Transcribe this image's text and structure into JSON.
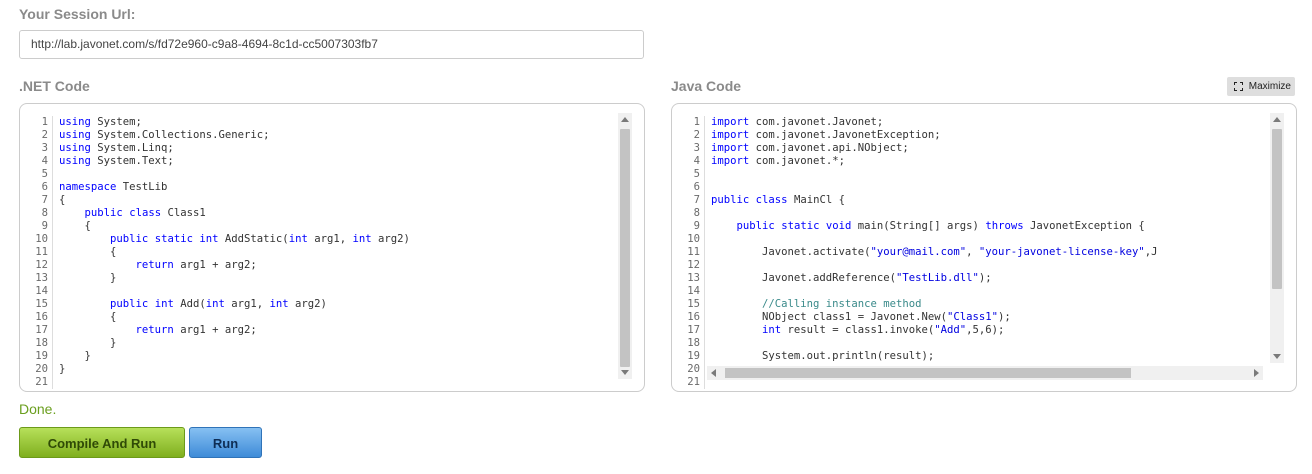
{
  "session": {
    "label": "Your Session Url:",
    "url": "http://lab.javonet.com/s/fd72e960-c9a8-4694-8c1d-cc5007303fb7"
  },
  "net": {
    "label": ".NET Code",
    "lines": [
      [
        {
          "t": "using",
          "c": "kw"
        },
        {
          "t": " System;"
        }
      ],
      [
        {
          "t": "using",
          "c": "kw"
        },
        {
          "t": " System.Collections.Generic;"
        }
      ],
      [
        {
          "t": "using",
          "c": "kw"
        },
        {
          "t": " System.Linq;"
        }
      ],
      [
        {
          "t": "using",
          "c": "kw"
        },
        {
          "t": " System.Text;"
        }
      ],
      [],
      [
        {
          "t": "namespace",
          "c": "kw"
        },
        {
          "t": " TestLib"
        }
      ],
      [
        {
          "t": "{"
        }
      ],
      [
        {
          "t": "    "
        },
        {
          "t": "public",
          "c": "kw"
        },
        {
          "t": " "
        },
        {
          "t": "class",
          "c": "kw"
        },
        {
          "t": " Class1"
        }
      ],
      [
        {
          "t": "    {"
        }
      ],
      [
        {
          "t": "        "
        },
        {
          "t": "public",
          "c": "kw"
        },
        {
          "t": " "
        },
        {
          "t": "static",
          "c": "kw"
        },
        {
          "t": " "
        },
        {
          "t": "int",
          "c": "kw"
        },
        {
          "t": " AddStatic("
        },
        {
          "t": "int",
          "c": "kw"
        },
        {
          "t": " arg1, "
        },
        {
          "t": "int",
          "c": "kw"
        },
        {
          "t": " arg2)"
        }
      ],
      [
        {
          "t": "        {"
        }
      ],
      [
        {
          "t": "            "
        },
        {
          "t": "return",
          "c": "kw"
        },
        {
          "t": " arg1 + arg2;"
        }
      ],
      [
        {
          "t": "        }"
        }
      ],
      [],
      [
        {
          "t": "        "
        },
        {
          "t": "public",
          "c": "kw"
        },
        {
          "t": " "
        },
        {
          "t": "int",
          "c": "kw"
        },
        {
          "t": " Add("
        },
        {
          "t": "int",
          "c": "kw"
        },
        {
          "t": " arg1, "
        },
        {
          "t": "int",
          "c": "kw"
        },
        {
          "t": " arg2)"
        }
      ],
      [
        {
          "t": "        {"
        }
      ],
      [
        {
          "t": "            "
        },
        {
          "t": "return",
          "c": "kw"
        },
        {
          "t": " arg1 + arg2;"
        }
      ],
      [
        {
          "t": "        }"
        }
      ],
      [
        {
          "t": "    }"
        }
      ],
      [
        {
          "t": "}"
        }
      ],
      []
    ]
  },
  "java": {
    "label": "Java Code",
    "maximize_label": "Maximize",
    "lines": [
      [
        {
          "t": "import",
          "c": "kw"
        },
        {
          "t": " com.javonet.Javonet;"
        }
      ],
      [
        {
          "t": "import",
          "c": "kw"
        },
        {
          "t": " com.javonet.JavonetException;"
        }
      ],
      [
        {
          "t": "import",
          "c": "kw"
        },
        {
          "t": " com.javonet.api.NObject;"
        }
      ],
      [
        {
          "t": "import",
          "c": "kw"
        },
        {
          "t": " com.javonet.*;"
        }
      ],
      [],
      [],
      [
        {
          "t": "public",
          "c": "kw"
        },
        {
          "t": " "
        },
        {
          "t": "class",
          "c": "kw"
        },
        {
          "t": " MainCl {"
        }
      ],
      [],
      [
        {
          "t": "    "
        },
        {
          "t": "public",
          "c": "kw"
        },
        {
          "t": " "
        },
        {
          "t": "static",
          "c": "kw"
        },
        {
          "t": " "
        },
        {
          "t": "void",
          "c": "kw"
        },
        {
          "t": " main(String[] args) "
        },
        {
          "t": "throws",
          "c": "kw"
        },
        {
          "t": " JavonetException {"
        }
      ],
      [],
      [
        {
          "t": "        Javonet.activate("
        },
        {
          "t": "\"your@mail.com\"",
          "c": "str"
        },
        {
          "t": ", "
        },
        {
          "t": "\"your-javonet-license-key\"",
          "c": "str"
        },
        {
          "t": ",J"
        }
      ],
      [],
      [
        {
          "t": "        Javonet.addReference("
        },
        {
          "t": "\"TestLib.dll\"",
          "c": "str"
        },
        {
          "t": ");"
        }
      ],
      [],
      [
        {
          "t": "        //Calling instance method",
          "c": "cm"
        }
      ],
      [
        {
          "t": "        NObject class1 = Javonet.New("
        },
        {
          "t": "\"Class1\"",
          "c": "str"
        },
        {
          "t": ");"
        }
      ],
      [
        {
          "t": "        "
        },
        {
          "t": "int",
          "c": "kw"
        },
        {
          "t": " result = class1.invoke("
        },
        {
          "t": "\"Add\"",
          "c": "str"
        },
        {
          "t": ",5,6);"
        }
      ],
      [],
      [
        {
          "t": "        System.out.println(result);"
        }
      ],
      [],
      []
    ]
  },
  "status": "Done.",
  "buttons": {
    "compile": "Compile And Run",
    "run": "Run"
  }
}
